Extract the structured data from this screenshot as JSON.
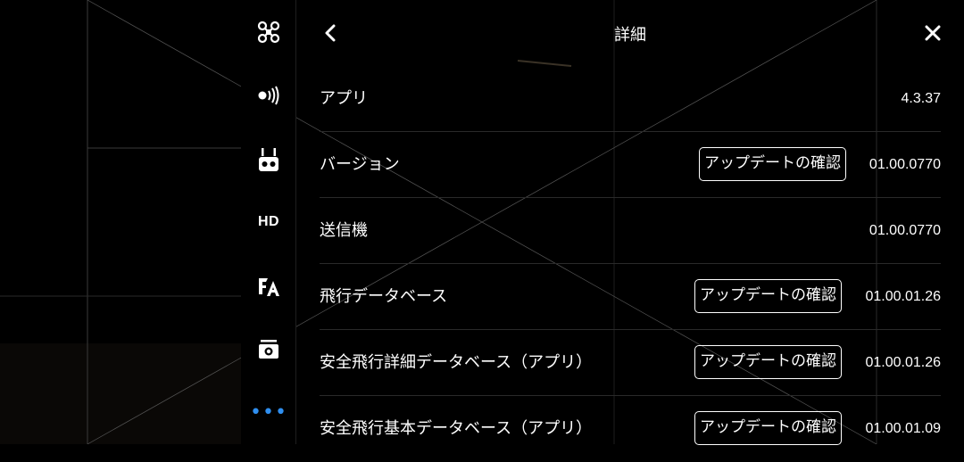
{
  "header": {
    "title": "詳細",
    "back_icon": "chevron-left-icon",
    "close_icon": "close-icon"
  },
  "rail": {
    "items": [
      {
        "name": "aircraft",
        "icon": "drone-icon"
      },
      {
        "name": "signal",
        "icon": "signal-icon"
      },
      {
        "name": "remote-controller",
        "icon": "remote-controller-icon"
      },
      {
        "name": "hd",
        "label": "HD"
      },
      {
        "name": "language",
        "icon": "language-icon"
      },
      {
        "name": "camera",
        "icon": "camera-icon"
      },
      {
        "name": "more",
        "label": "•••",
        "icon": "more-icon"
      }
    ],
    "active_color": "#2f8ff0"
  },
  "rows": [
    {
      "label": "アプリ",
      "value": "4.3.37"
    },
    {
      "label": "バージョン",
      "value": "01.00.0770",
      "button": "アップデートの確認"
    },
    {
      "label": "送信機",
      "value": "01.00.0770"
    },
    {
      "label": "飛行データベース",
      "value": "01.00.01.26",
      "button": "アップデートの確認"
    },
    {
      "label": "安全飛行詳細データベース（アプリ）",
      "value": "01.00.01.26",
      "button": "アップデートの確認"
    },
    {
      "label": "安全飛行基本データベース（アプリ）",
      "value": "01.00.01.09",
      "button": "アップデートの確認"
    }
  ]
}
